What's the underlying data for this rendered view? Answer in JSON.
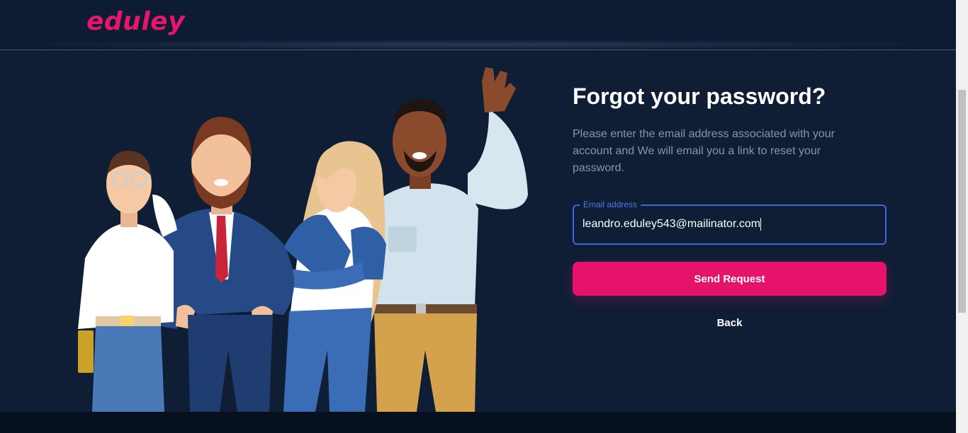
{
  "header": {
    "logo_text": "eduley"
  },
  "form": {
    "title": "Forgot your password?",
    "description": "Please enter the email address associated with your account and We will email you a link to reset your password.",
    "email_label": "Email address",
    "email_value": "leandro.eduley543@mailinator.com",
    "send_label": "Send Request",
    "back_label": "Back"
  },
  "colors": {
    "background": "#0f1e35",
    "brand_pink": "#e5136a",
    "focus_blue": "#3d66e5",
    "muted_text": "#8a94a6"
  },
  "illustration": {
    "icon": "team-people-illustration"
  }
}
